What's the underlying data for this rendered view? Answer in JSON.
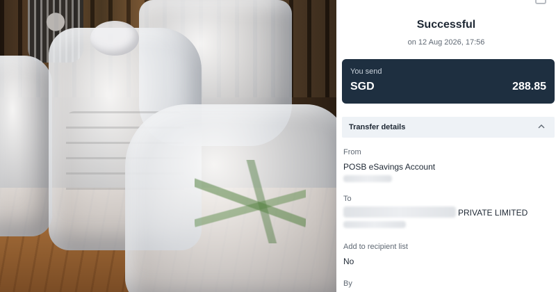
{
  "receipt": {
    "title": "Successful",
    "timestamp": "on 12 Aug 2026, 17:56",
    "send": {
      "label": "You send",
      "currency": "SGD",
      "amount": "288.85"
    },
    "details": {
      "header": "Transfer details",
      "expand_icon": "chevron-up-icon",
      "from_label": "From",
      "from_value": "POSB eSavings Account",
      "to_label": "To",
      "to_value_visible": "PRIVATE LIMITED",
      "add_recipient_label": "Add to recipient list",
      "add_recipient_value": "No",
      "by_label": "By"
    }
  },
  "colors": {
    "card_background": "#1e2f40",
    "section_background": "#eef2f6",
    "text_primary": "#1d2733",
    "text_secondary": "#5f6873"
  }
}
